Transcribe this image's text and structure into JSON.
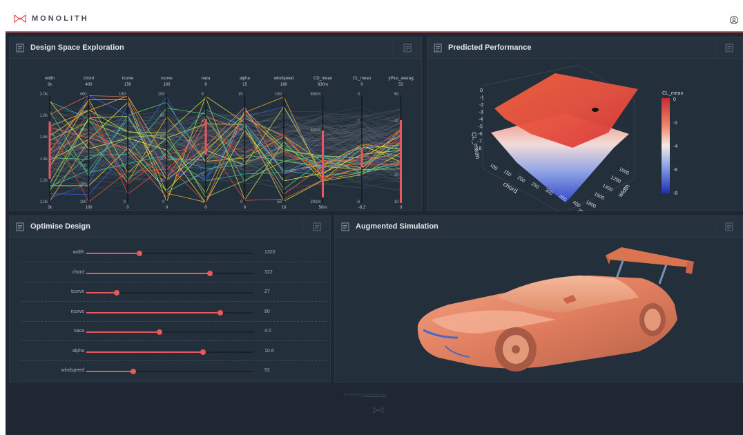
{
  "brand": {
    "name": "MONOLITH"
  },
  "panels": {
    "design": {
      "title": "Design Space Exploration"
    },
    "predicted": {
      "title": "Predicted Performance"
    },
    "optimise": {
      "title": "Optimise Design"
    },
    "augmented": {
      "title": "Augmented Simulation"
    }
  },
  "parallel_axes": [
    {
      "name": "width",
      "max": "2k",
      "min": "2k",
      "ticks": [
        "2.0k",
        "1.8k",
        "1.6k",
        "1.4k",
        "1.2k",
        "1.0k"
      ]
    },
    {
      "name": "chord",
      "max": "400",
      "min": "100",
      "ticks": [
        "400",
        "350",
        "300",
        "250",
        "200",
        "150",
        "100"
      ]
    },
    {
      "name": "tcurve",
      "max": "150",
      "min": "0",
      "ticks": [
        "150",
        "100",
        "50",
        "0"
      ]
    },
    {
      "name": "rcurve",
      "max": "100",
      "min": "0",
      "ticks": [
        "100",
        "80",
        "60",
        "40",
        "20",
        "0"
      ]
    },
    {
      "name": "naca",
      "max": "9",
      "min": "0",
      "ticks": [
        "8",
        "6",
        "4",
        "2",
        "0"
      ]
    },
    {
      "name": "alpha",
      "max": "15",
      "min": "0",
      "ticks": [
        "15",
        "10",
        "5",
        "0"
      ]
    },
    {
      "name": "windspeed",
      "max": "160",
      "min": "10",
      "ticks": [
        "150",
        "100",
        "50"
      ]
    },
    {
      "name": "CD_mean",
      "max": "930m",
      "min": "50m",
      "ticks": [
        "800m",
        "600m",
        "400m",
        "200m"
      ]
    },
    {
      "name": "CL_mean",
      "max": "0",
      "min": "-8.2",
      "ticks": [
        "0",
        "-2",
        "-4",
        "-6",
        "-8"
      ]
    },
    {
      "name": "yPlus_averag",
      "max": "53",
      "min": "3",
      "ticks": [
        "50",
        "40",
        "30",
        "20",
        "10"
      ]
    }
  ],
  "surface": {
    "z_label": "CL_mean",
    "x_label": "chord",
    "y_label": "width",
    "z_ticks": [
      "0",
      "-1",
      "-2",
      "-3",
      "-4",
      "-5",
      "-6",
      "-7",
      "-8"
    ],
    "chord_ticks": [
      "100",
      "150",
      "200",
      "250",
      "300",
      "350",
      "400"
    ],
    "width_ticks": [
      "1000",
      "1200",
      "1400",
      "1600",
      "1800",
      "2000"
    ],
    "colorbar_title": "CL_mean",
    "colorbar_ticks": [
      "0",
      "-2",
      "-4",
      "-6",
      "-8"
    ],
    "colors": {
      "high": "#d7353a",
      "mid": "#f3ece6",
      "low": "#1f2fb0"
    }
  },
  "sliders": [
    {
      "label": "width",
      "value": "1320",
      "fraction": 0.32
    },
    {
      "label": "chord",
      "value": "322",
      "fraction": 0.74
    },
    {
      "label": "tcurve",
      "value": "27",
      "fraction": 0.18
    },
    {
      "label": "rcurve",
      "value": "80",
      "fraction": 0.8
    },
    {
      "label": "naca",
      "value": "4.0",
      "fraction": 0.44
    },
    {
      "label": "alpha",
      "value": "10.6",
      "fraction": 0.7
    },
    {
      "label": "windspeed",
      "value": "52",
      "fraction": 0.28
    }
  ],
  "footer": {
    "prefix": "Powered by",
    "link": "monolithai.com"
  },
  "colors": {
    "accent": "#e8585c",
    "background": "#1f2832",
    "panel": "#232f3b"
  }
}
